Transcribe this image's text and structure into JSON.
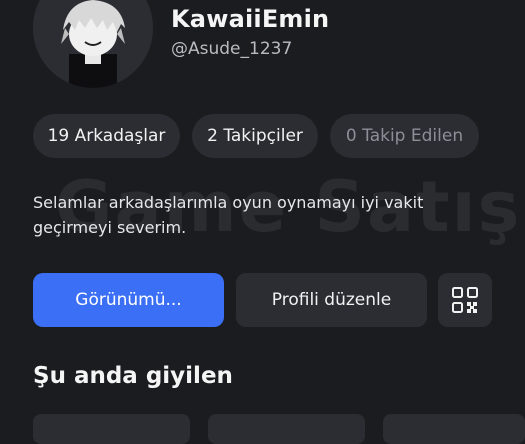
{
  "profile": {
    "display_name": "KawaiiEmin",
    "username": "@Asude_1237"
  },
  "stats": {
    "friends": "19 Arkadaşlar",
    "followers": "2 Takipçiler",
    "following": "0 Takip Edilen"
  },
  "bio": "Selamlar arkadaşlarımla oyun oynamayı iyi vakit geçirmeyi severim.",
  "watermark": "Game Satış",
  "actions": {
    "view_label": "Görünümü...",
    "edit_label": "Profili düzenle",
    "qr_icon": "qr-code-icon"
  },
  "section": {
    "title": "Şu anda giyilen"
  },
  "colors": {
    "background": "#1b1c20",
    "surface": "#2b2d33",
    "accent": "#3b6ff5"
  }
}
